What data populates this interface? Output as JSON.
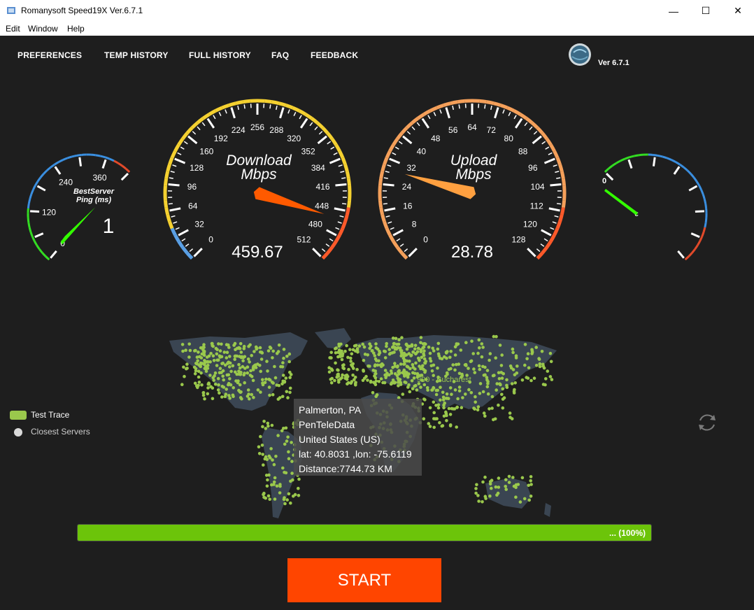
{
  "window": {
    "title": "Romanysoft Speed19X Ver.6.7.1",
    "minimize": "—",
    "maximize": "☐",
    "close": "✕"
  },
  "menubar": [
    "Edit",
    "Window",
    "Help"
  ],
  "nav": [
    "PREFERENCES",
    "TEMP HISTORY",
    "FULL HISTORY",
    "FAQ",
    "FEEDBACK"
  ],
  "version_label": "Ver 6.7.1",
  "ping_gauge": {
    "title_line1": "BestServer",
    "title_line2": "Ping (ms)",
    "ticks": [
      "0",
      "120",
      "240",
      "360"
    ],
    "value": "1",
    "needle_value": 1,
    "max": 420
  },
  "download_gauge": {
    "title_line1": "Download",
    "title_line2": "Mbps",
    "ticks": [
      "0",
      "32",
      "64",
      "96",
      "128",
      "160",
      "192",
      "224",
      "256",
      "288",
      "320",
      "352",
      "384",
      "416",
      "448",
      "480",
      "512"
    ],
    "value": "459.67",
    "needle_value": 459.67,
    "max": 512
  },
  "upload_gauge": {
    "title_line1": "Upload",
    "title_line2": "Mbps",
    "ticks": [
      "0",
      "8",
      "16",
      "24",
      "32",
      "40",
      "48",
      "56",
      "64",
      "72",
      "80",
      "88",
      "96",
      "104",
      "112",
      "120",
      "128"
    ],
    "value": "28.78",
    "needle_value": 28.78,
    "max": 128
  },
  "jitter_gauge": {
    "tick_0": "0",
    "needle_label": "c",
    "needle_fraction": 0.15
  },
  "legend": {
    "test_trace": "Test Trace",
    "closest_servers": "Closest Servers"
  },
  "map": {
    "label": "990 - Bucharest",
    "info": {
      "city": "Palmerton, PA",
      "isp": "PenTeleData",
      "country": "United States (US)",
      "coords": "lat: 40.8031 ,lon: -75.6119",
      "distance": "Distance:7744.73 KM"
    }
  },
  "progress": {
    "text": "... (100%)",
    "percent": 100
  },
  "start_button": "START",
  "colors": {
    "background": "#1e1e1e",
    "accent_green": "#6cc40a",
    "map_dots": "#9ac84c",
    "start": "#ff4500",
    "download_rim": "#f5d130",
    "upload_rim": "#f5a05a",
    "needle": "#ff5a00"
  }
}
